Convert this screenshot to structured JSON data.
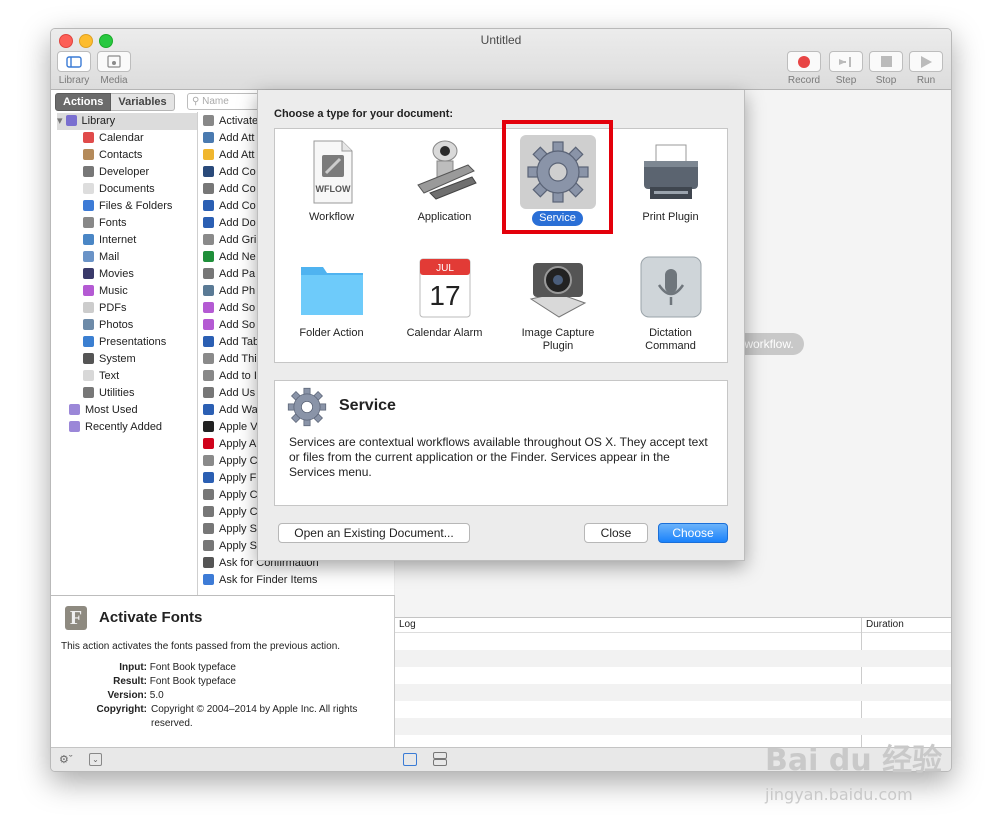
{
  "window": {
    "title": "Untitled"
  },
  "toolbar": {
    "library_label": "Library",
    "media_label": "Media",
    "record_label": "Record",
    "step_label": "Step",
    "stop_label": "Stop",
    "run_label": "Run"
  },
  "library": {
    "tab_actions": "Actions",
    "tab_variables": "Variables",
    "search_placeholder": "Name",
    "items": [
      {
        "label": "Library",
        "icon": "library-icon",
        "color": "#7a6fd0"
      },
      {
        "label": "Calendar",
        "icon": "calendar-icon",
        "color": "#e04b4b"
      },
      {
        "label": "Contacts",
        "icon": "contacts-icon",
        "color": "#b48a5a"
      },
      {
        "label": "Developer",
        "icon": "developer-icon",
        "color": "#777777"
      },
      {
        "label": "Documents",
        "icon": "documents-icon",
        "color": "#dddddd"
      },
      {
        "label": "Files & Folders",
        "icon": "files-folders-icon",
        "color": "#3d7bd6"
      },
      {
        "label": "Fonts",
        "icon": "fonts-icon",
        "color": "#888888"
      },
      {
        "label": "Internet",
        "icon": "internet-icon",
        "color": "#4a86c5"
      },
      {
        "label": "Mail",
        "icon": "mail-icon",
        "color": "#6a93c7"
      },
      {
        "label": "Movies",
        "icon": "movies-icon",
        "color": "#3a3a6a"
      },
      {
        "label": "Music",
        "icon": "music-icon",
        "color": "#b45ad3"
      },
      {
        "label": "PDFs",
        "icon": "pdfs-icon",
        "color": "#cccccc"
      },
      {
        "label": "Photos",
        "icon": "photos-icon",
        "color": "#6d8aa8"
      },
      {
        "label": "Presentations",
        "icon": "presentations-icon",
        "color": "#3b7fd1"
      },
      {
        "label": "System",
        "icon": "system-icon",
        "color": "#555555"
      },
      {
        "label": "Text",
        "icon": "text-icon",
        "color": "#d8d8d8"
      },
      {
        "label": "Utilities",
        "icon": "utilities-icon",
        "color": "#777777"
      },
      {
        "label": "Most Used",
        "icon": "most-used-icon",
        "color": "#9b87d8"
      },
      {
        "label": "Recently Added",
        "icon": "recently-added-icon",
        "color": "#9b87d8"
      }
    ],
    "actions": [
      {
        "label": "Activate",
        "color": "#888888"
      },
      {
        "label": "Add Att",
        "color": "#4a7ab0"
      },
      {
        "label": "Add Att",
        "color": "#f0b62e"
      },
      {
        "label": "Add Co",
        "color": "#2a4a7a"
      },
      {
        "label": "Add Co",
        "color": "#777777"
      },
      {
        "label": "Add Co",
        "color": "#2b5fb3"
      },
      {
        "label": "Add Do",
        "color": "#2b5fb3"
      },
      {
        "label": "Add Gri",
        "color": "#8a8a8a"
      },
      {
        "label": "Add Ne",
        "color": "#1f8f3a"
      },
      {
        "label": "Add Pa",
        "color": "#777777"
      },
      {
        "label": "Add Ph",
        "color": "#5a7a95"
      },
      {
        "label": "Add So",
        "color": "#b45ad3"
      },
      {
        "label": "Add So",
        "color": "#b45ad3"
      },
      {
        "label": "Add Tab",
        "color": "#2b5fb3"
      },
      {
        "label": "Add Thi",
        "color": "#8a8a8a"
      },
      {
        "label": "Add to I",
        "color": "#888888"
      },
      {
        "label": "Add Us",
        "color": "#777777"
      },
      {
        "label": "Add Wa",
        "color": "#2b5fb3"
      },
      {
        "label": "Apple V",
        "color": "#222222"
      },
      {
        "label": "Apply A",
        "color": "#d0021b"
      },
      {
        "label": "Apply C",
        "color": "#8a8a8a"
      },
      {
        "label": "Apply F",
        "color": "#2b5fb3"
      },
      {
        "label": "Apply C",
        "color": "#777777"
      },
      {
        "label": "Apply C",
        "color": "#777777"
      },
      {
        "label": "Apply S",
        "color": "#777777"
      },
      {
        "label": "Apply S",
        "color": "#777777"
      },
      {
        "label": "Ask for Confirmation",
        "color": "#555555"
      },
      {
        "label": "Ask for Finder Items",
        "color": "#3d7bd6"
      }
    ]
  },
  "description": {
    "title": "Activate Fonts",
    "text": "This action activates the fonts passed from the previous action.",
    "input_label": "Input:",
    "input_value": "Font Book typeface",
    "result_label": "Result:",
    "result_value": "Font Book typeface",
    "version_label": "Version:",
    "version_value": "5.0",
    "copyright_label": "Copyright:",
    "copyright_value": "Copyright © 2004–2014 by Apple Inc. All rights reserved."
  },
  "workflow": {
    "hint": "r workflow."
  },
  "log": {
    "col_log": "Log",
    "col_duration": "Duration"
  },
  "sheet": {
    "title": "Choose a type for your document:",
    "types": [
      {
        "label": "Workflow",
        "icon": "workflow-icon",
        "badge": "WFLOW"
      },
      {
        "label": "Application",
        "icon": "application-icon"
      },
      {
        "label": "Service",
        "icon": "service-icon"
      },
      {
        "label": "Print Plugin",
        "icon": "print-plugin-icon"
      },
      {
        "label": "Folder Action",
        "icon": "folder-action-icon"
      },
      {
        "label": "Calendar Alarm",
        "icon": "calendar-alarm-icon",
        "month": "JUL",
        "day": "17"
      },
      {
        "label": "Image Capture Plugin",
        "icon": "image-capture-icon"
      },
      {
        "label": "Dictation Command",
        "icon": "dictation-icon"
      }
    ],
    "selected": "Service",
    "detail_title": "Service",
    "detail_text": "Services are contextual workflows available throughout OS X. They accept text or files from the current application or the Finder. Services appear in the Services menu.",
    "open_button": "Open an Existing Document...",
    "close_button": "Close",
    "choose_button": "Choose",
    "highlight_color": "#e3000b",
    "accent_color": "#2a6fd6"
  },
  "watermark": {
    "brand": "Bai du 经验",
    "url": "jingyan.baidu.com"
  }
}
